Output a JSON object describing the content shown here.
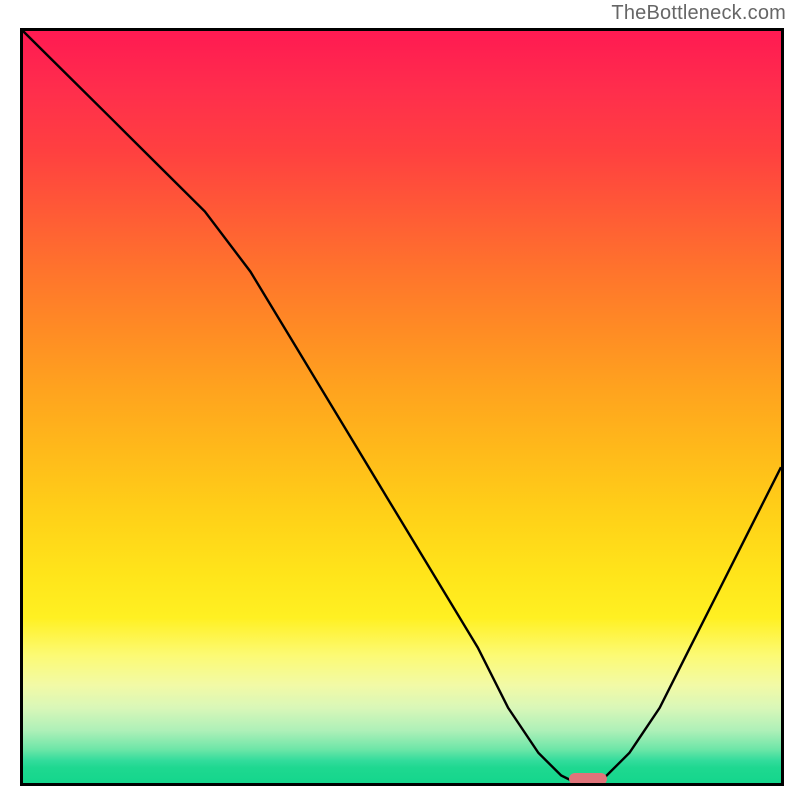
{
  "watermark": "TheBottleneck.com",
  "chart_data": {
    "type": "line",
    "title": "",
    "xlabel": "",
    "ylabel": "",
    "xlim": [
      0,
      100
    ],
    "ylim": [
      0,
      100
    ],
    "x": [
      0,
      6,
      12,
      18,
      24,
      30,
      36,
      42,
      48,
      54,
      60,
      64,
      68,
      71,
      73,
      76,
      80,
      84,
      88,
      92,
      96,
      100
    ],
    "values": [
      100,
      94,
      88,
      82,
      76,
      68,
      58,
      48,
      38,
      28,
      18,
      10,
      4,
      1,
      0,
      0,
      4,
      10,
      18,
      26,
      34,
      42
    ],
    "marker": {
      "x_start": 72,
      "x_end": 77,
      "y": 0
    },
    "gradient_colors": {
      "top": "#ff1a52",
      "mid_upper": "#ff9c20",
      "mid_lower": "#ffe81c",
      "bottom": "#14d68c"
    },
    "annotations": []
  }
}
